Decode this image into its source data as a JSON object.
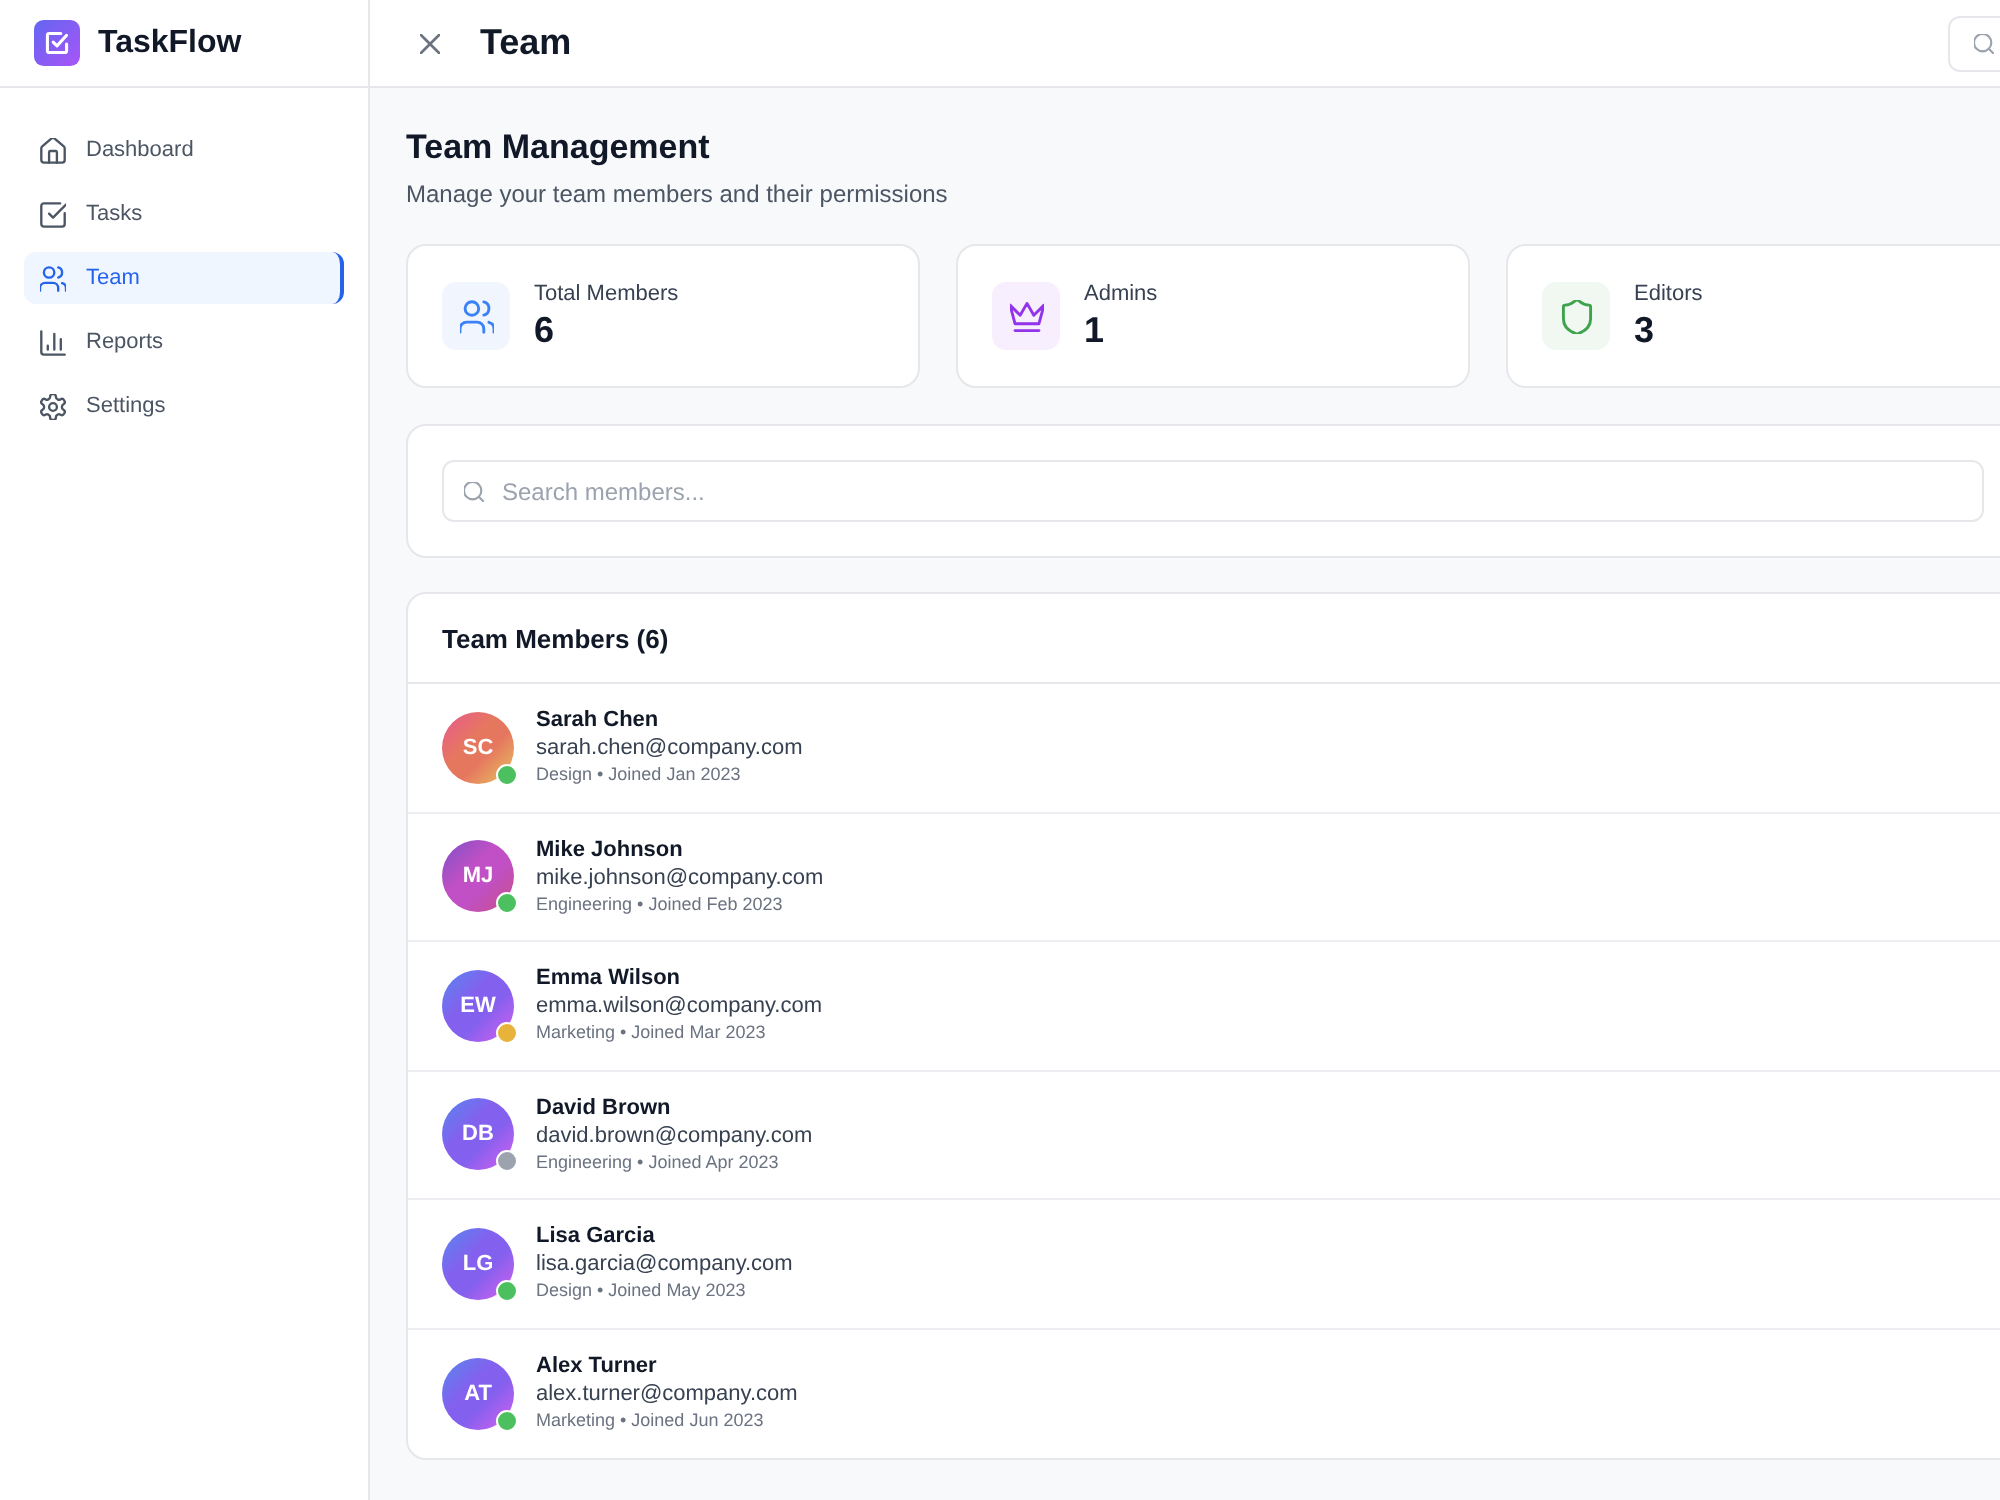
{
  "sidebar": {
    "brand": "TaskFlow",
    "items": [
      {
        "label": "Dashboard",
        "selected": false
      },
      {
        "label": "Tasks",
        "selected": false
      },
      {
        "label": "Team",
        "selected": true
      },
      {
        "label": "Reports",
        "selected": false
      },
      {
        "label": "Settings",
        "selected": false
      }
    ]
  },
  "header": {
    "title": "Team"
  },
  "page": {
    "title": "Team Management",
    "subtitle": "Manage your team members and their permissions"
  },
  "stats": [
    {
      "label": "Total Members",
      "value": "6",
      "color": "#3b82f6"
    },
    {
      "label": "Admins",
      "value": "1",
      "color": "#9333ea"
    },
    {
      "label": "Editors",
      "value": "3",
      "color": "#3fa34d"
    }
  ],
  "search": {
    "placeholder": "Search members..."
  },
  "members": {
    "title": "Team Members (6)",
    "rows": [
      {
        "avatar": {
          "initials": "SC",
          "color": "#e6775f"
        },
        "status": {
          "color": "#4cc05f"
        },
        "name": "Sarah Chen",
        "email": "sarah.chen@company.com",
        "meta": "Design • Joined Jan 2023"
      },
      {
        "avatar": {
          "initials": "MJ",
          "color": "#c150c6"
        },
        "status": {
          "color": "#4cc05f"
        },
        "name": "Mike Johnson",
        "email": "mike.johnson@company.com",
        "meta": "Engineering • Joined Feb 2023"
      },
      {
        "avatar": {
          "initials": "EW",
          "color": "#8460ee"
        },
        "status": {
          "color": "#e8b33a"
        },
        "name": "Emma Wilson",
        "email": "emma.wilson@company.com",
        "meta": "Marketing • Joined Mar 2023"
      },
      {
        "avatar": {
          "initials": "DB",
          "color": "#8460ee"
        },
        "status": {
          "color": "#9ca3af"
        },
        "name": "David Brown",
        "email": "david.brown@company.com",
        "meta": "Engineering • Joined Apr 2023"
      },
      {
        "avatar": {
          "initials": "LG",
          "color": "#8460ee"
        },
        "status": {
          "color": "#4cc05f"
        },
        "name": "Lisa Garcia",
        "email": "lisa.garcia@company.com",
        "meta": "Design • Joined May 2023"
      },
      {
        "avatar": {
          "initials": "AT",
          "color": "#8460ee"
        },
        "status": {
          "color": "#4cc05f"
        },
        "name": "Alex Turner",
        "email": "alex.turner@company.com",
        "meta": "Marketing • Joined Jun 2023"
      }
    ]
  }
}
